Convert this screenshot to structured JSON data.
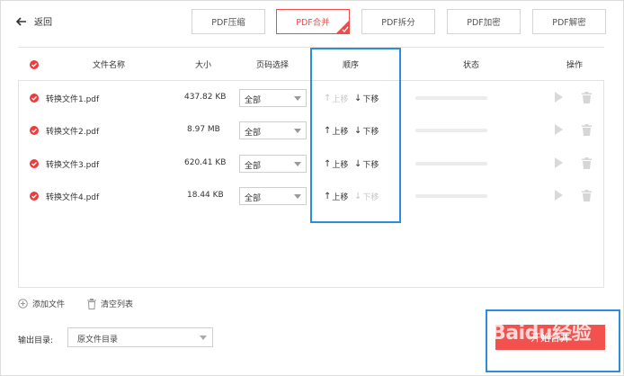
{
  "header": {
    "back_label": "返回",
    "tabs": [
      {
        "label": "PDF压缩",
        "active": false
      },
      {
        "label": "PDF合并",
        "active": true
      },
      {
        "label": "PDF拆分",
        "active": false
      },
      {
        "label": "PDF加密",
        "active": false
      },
      {
        "label": "PDF解密",
        "active": false
      }
    ]
  },
  "table": {
    "columns": {
      "name": "文件名称",
      "size": "大小",
      "pages": "页码选择",
      "order": "顺序",
      "status": "状态",
      "actions": "操作"
    },
    "move_up_label": "上移",
    "move_down_label": "下移",
    "rows": [
      {
        "name": "转换文件1.pdf",
        "size": "437.82 KB",
        "pages": "全部",
        "up_enabled": false,
        "down_enabled": true,
        "progress": 0
      },
      {
        "name": "转换文件2.pdf",
        "size": "8.97 MB",
        "pages": "全部",
        "up_enabled": true,
        "down_enabled": true,
        "progress": 0
      },
      {
        "name": "转换文件3.pdf",
        "size": "620.41 KB",
        "pages": "全部",
        "up_enabled": true,
        "down_enabled": true,
        "progress": 0
      },
      {
        "name": "转换文件4.pdf",
        "size": "18.44 KB",
        "pages": "全部",
        "up_enabled": true,
        "down_enabled": false,
        "progress": 0
      }
    ]
  },
  "footer": {
    "add_file_label": "添加文件",
    "clear_list_label": "清空列表",
    "output_dir_label": "输出目录:",
    "output_dir_value": "原文件目录",
    "start_label": "开始合并"
  },
  "watermark": "Baidu经验",
  "colors": {
    "accent": "#f04b4b",
    "highlight": "#2e8ddb"
  }
}
